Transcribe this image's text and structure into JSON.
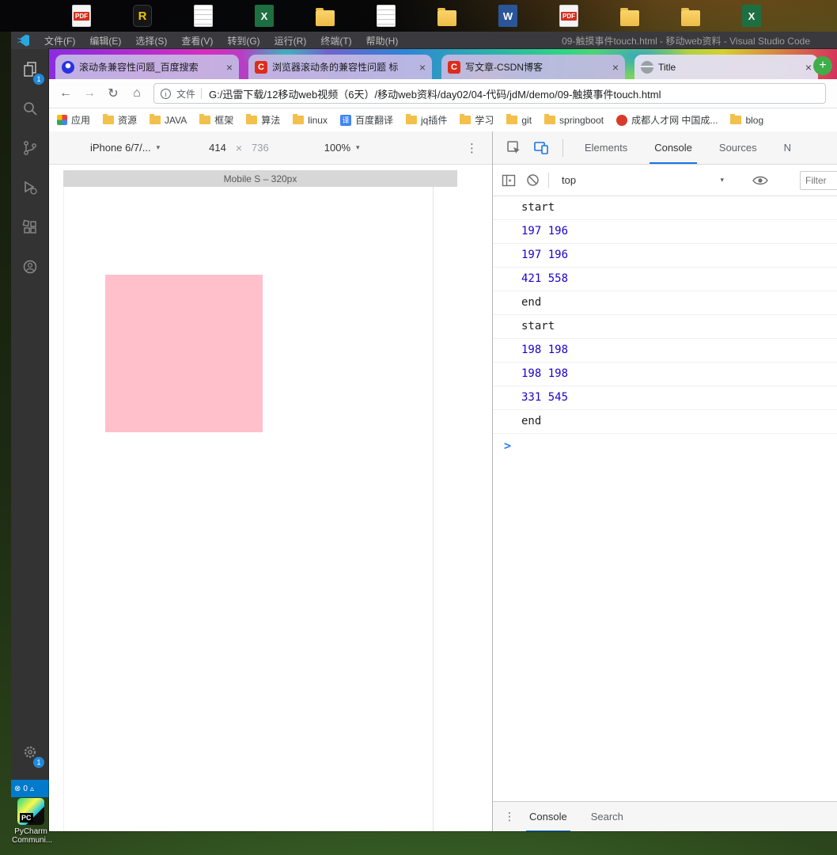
{
  "desktop": {
    "icons": [
      {
        "kind": "pdf",
        "glyph": "PDF"
      },
      {
        "kind": "app",
        "glyph": "R"
      },
      {
        "kind": "text",
        "glyph": ""
      },
      {
        "kind": "excel",
        "glyph": "X"
      },
      {
        "kind": "folder",
        "glyph": ""
      },
      {
        "kind": "text",
        "glyph": ""
      },
      {
        "kind": "folder",
        "glyph": ""
      },
      {
        "kind": "word",
        "glyph": "W"
      },
      {
        "kind": "pdf",
        "glyph": "PDF"
      },
      {
        "kind": "folder",
        "glyph": ""
      },
      {
        "kind": "folder",
        "glyph": ""
      },
      {
        "kind": "excel",
        "glyph": "X"
      }
    ],
    "pycharm": {
      "line1": "PyCharm",
      "line2": "Communi..."
    }
  },
  "vscode": {
    "menu_items": [
      "文件(F)",
      "编辑(E)",
      "选择(S)",
      "查看(V)",
      "转到(G)",
      "运行(R)",
      "终端(T)",
      "帮助(H)"
    ],
    "window_title": "09-触摸事件touch.html - 移动web资料 - Visual Studio Code",
    "explorer_badge": "1",
    "manage_badge": "1",
    "statusbar": {
      "errors": "0"
    }
  },
  "chrome": {
    "tabs": [
      {
        "title": "滚动条兼容性问题_百度搜索"
      },
      {
        "title": "浏览器滚动条的兼容性问题 标"
      },
      {
        "title": "写文章-CSDN博客"
      },
      {
        "title": "Title"
      }
    ],
    "address_bar": {
      "scheme_label": "文件",
      "url": "G:/迅雷下载/12移动web视频（6天）/移动web资料/day02/04-代码/jdM/demo/09-触摸事件touch.html"
    },
    "bookmarks": [
      {
        "label": "应用"
      },
      {
        "label": "资源"
      },
      {
        "label": "JAVA"
      },
      {
        "label": "框架"
      },
      {
        "label": "算法"
      },
      {
        "label": "linux"
      },
      {
        "label": "百度翻译"
      },
      {
        "label": "jq插件"
      },
      {
        "label": "学习"
      },
      {
        "label": "git"
      },
      {
        "label": "springboot"
      },
      {
        "label": "成都人才网 中国成..."
      },
      {
        "label": "blog"
      }
    ],
    "favicon_glyphs": {
      "csdn": "C",
      "translate": "译"
    }
  },
  "devtools": {
    "device_bar": {
      "device": "iPhone 6/7/...",
      "width": "414",
      "height": "736",
      "zoom": "100%"
    },
    "ruler_label": "Mobile S – 320px",
    "panel_tabs": [
      "Elements",
      "Console",
      "Sources",
      "N"
    ],
    "console_toolbar": {
      "context": "top",
      "filter_placeholder": "Filter"
    },
    "console_rows": [
      "start",
      "197 196",
      "197 196",
      "421 558",
      "end",
      "start",
      "198 198",
      "198 198",
      "331 545",
      "end"
    ],
    "drawer_tabs": [
      "Console",
      "Search"
    ]
  },
  "page": {
    "square_color": "#ffc0cb"
  },
  "glyphs": {
    "back": "←",
    "forward": "→",
    "reload": "↻",
    "home": "⌂",
    "info": "i",
    "caret": "▾",
    "times": "×",
    "more": "⋮",
    "close": "×",
    "new_tab": "+",
    "prompt": ">",
    "error": "⊗",
    "warning": "▵"
  }
}
